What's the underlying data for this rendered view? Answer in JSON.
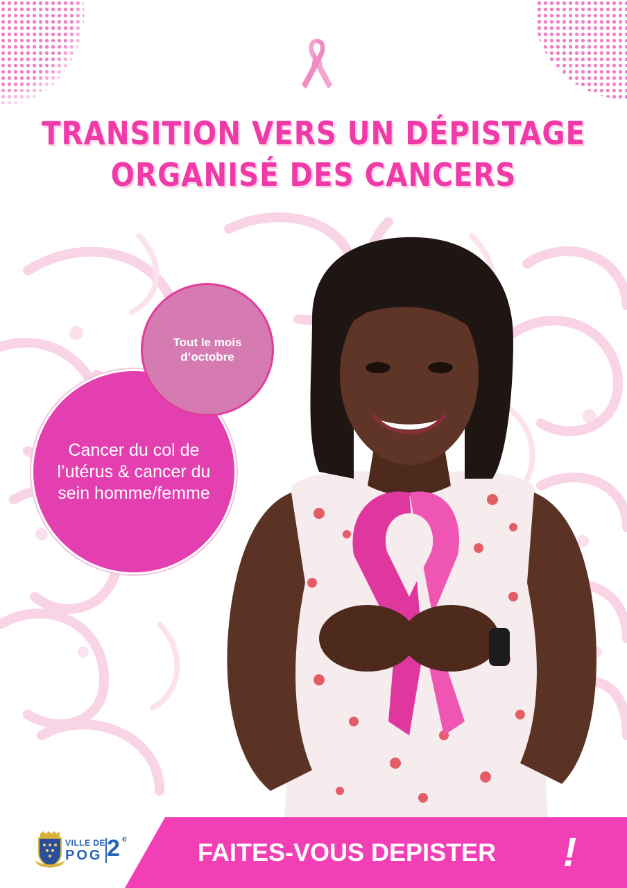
{
  "headline": {
    "line1": "TRANSITION VERS UN DÉPISTAGE",
    "line2": "ORGANISÉ DES CANCERS"
  },
  "bubbles": {
    "month": "Tout le mois d’octobre",
    "cancer": "Cancer du col de l’utérus & cancer du sein homme/femme"
  },
  "cta": {
    "text": "FAITES-VOUS DEPISTER",
    "exclaim": "!"
  },
  "logo": {
    "ville_de": "VILLE DE",
    "pog": "POG",
    "arrondissement": "2",
    "superscript": "e"
  },
  "colors": {
    "accent_pink": "#ef3aa8",
    "bubble_dark": "#e43fb0",
    "bubble_light": "#d57bb2",
    "cta_bar": "#f23fb6",
    "logo_blue": "#2a63b5"
  },
  "icons": [
    "pink-ribbon-icon",
    "city-crest-icon"
  ]
}
